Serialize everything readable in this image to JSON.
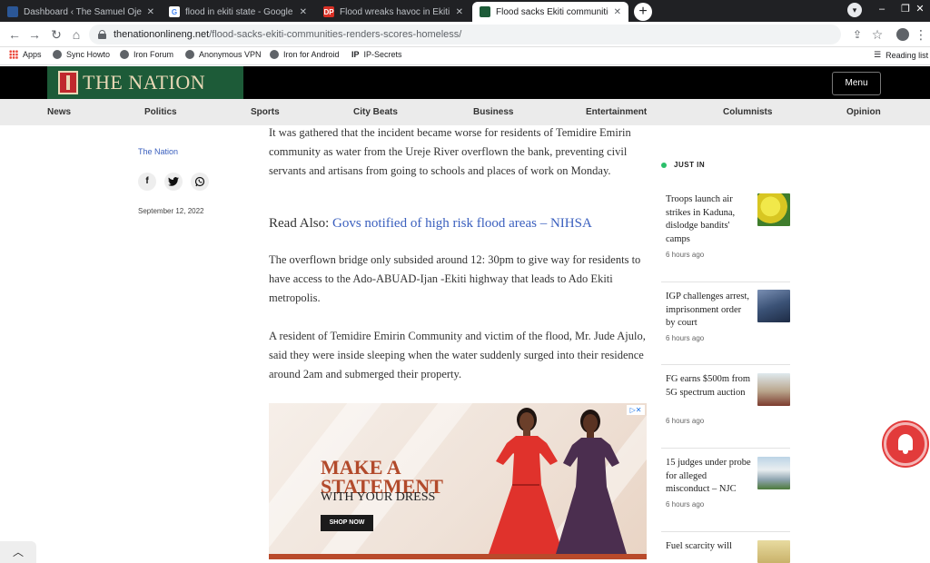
{
  "browser": {
    "tabs": [
      {
        "title": "Dashboard ‹ The Samuel Ojekwe",
        "active": false,
        "favicon_color": "#1a4f8b"
      },
      {
        "title": "flood in ekiti state - Google Sear",
        "active": false,
        "favicon_color": "#4285f4"
      },
      {
        "title": "Flood wreaks havoc in Ekiti comm",
        "active": false,
        "favicon_color": "#d93025"
      },
      {
        "title": "Flood sacks Ekiti communities, re",
        "active": true,
        "favicon_color": "#1d5b38"
      }
    ],
    "new_tab": "+",
    "url_host": "thenationonlineng.net",
    "url_path": "/flood-sacks-ekiti-communities-renders-scores-homeless/",
    "bookmarks": [
      "Apps",
      "Sync Howto",
      "Iron Forum",
      "Anonymous VPN",
      "Iron for Android",
      "IP-Secrets"
    ],
    "reading_list": "Reading list"
  },
  "site": {
    "logo_text": "THE NATION",
    "menu_label": "Menu",
    "categories": [
      "News",
      "Politics",
      "Sports",
      "City Beats",
      "Business",
      "Entertainment",
      "Columnists",
      "Opinion"
    ]
  },
  "article": {
    "source": "The Nation",
    "date": "September 12, 2022",
    "paragraphs": [
      "It was gathered that the incident became worse for residents of Temidire Emirin community as water from the Ureje River overflown the bank, preventing civil servants and artisans from going to schools and places of work on Monday.",
      "The overflown bridge only subsided around 12: 30pm to give way for residents to have access to the Ado-ABUAD-Ijan -Ekiti highway that leads to Ado Ekiti metropolis.",
      "A resident of Temidire Emirin Community and victim of the flood, Mr. Jude Ajulo, said they were inside sleeping when the water suddenly surged into their residence around 2am and submerged their property."
    ],
    "read_also_label": "Read Also:",
    "read_also_link": "Govs notified of high risk flood areas – NIHSA"
  },
  "ad": {
    "line1": "MAKE A",
    "line2": "STATEMENT",
    "line3": "WITH YOUR DRESS",
    "cta": "SHOP NOW"
  },
  "sidebar": {
    "heading": "JUST IN",
    "stories": [
      {
        "headline": "Troops launch air strikes in Kaduna, dislodge bandits' camps",
        "time": "6 hours ago",
        "thumb_color": "#d8c622"
      },
      {
        "headline": "IGP challenges arrest, imprisonment order by court",
        "time": "6 hours ago",
        "thumb_color": "#3b5276"
      },
      {
        "headline": "FG earns $500m from 5G spectrum auction",
        "time": "6 hours ago",
        "thumb_color": "#b9a58c"
      },
      {
        "headline": "15 judges under probe for alleged misconduct – NJC",
        "time": "6 hours ago",
        "thumb_color": "#8fa4b0"
      },
      {
        "headline": "Fuel scarcity will",
        "time": "",
        "thumb_color": "#c9b26a"
      }
    ]
  },
  "colors": {
    "accent": "#3a5fbe",
    "brand_green": "#1d5b38",
    "notification": "#e23b3b"
  }
}
